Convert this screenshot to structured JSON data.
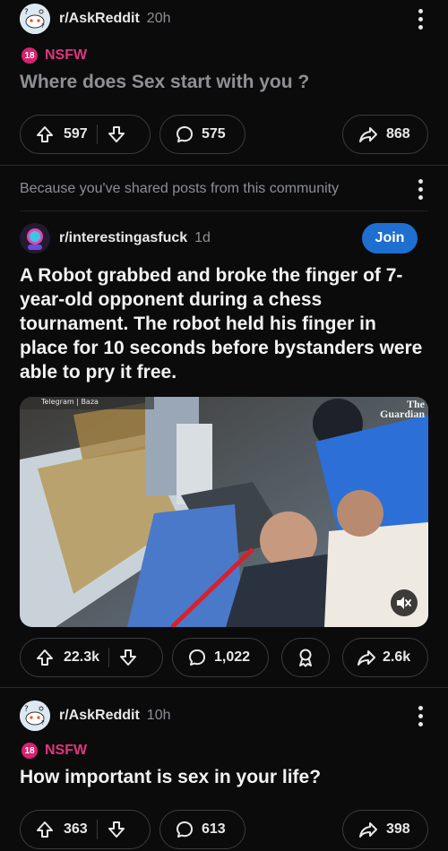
{
  "post1": {
    "subreddit": "r/AskReddit",
    "time": "20h",
    "nsfw_badge": "18",
    "nsfw_label": "NSFW",
    "title": "Where does Sex start with you ?",
    "upvotes": "597",
    "comments": "575",
    "shares": "868"
  },
  "recommendation": {
    "text": "Because you've shared posts from this community"
  },
  "post2": {
    "subreddit": "r/interestingasfuck",
    "time": "1d",
    "join_label": "Join",
    "title": "A Robot grabbed and broke the finger of 7-year-old opponent during a chess tournament. The robot held his finger in place for 10 seconds before bystanders were able to pry it free.",
    "video_watermark": "Telegram | Baza",
    "video_logo": "The Guardian",
    "upvotes": "22.3k",
    "comments": "1,022",
    "shares": "2.6k"
  },
  "post3": {
    "subreddit": "r/AskReddit",
    "time": "10h",
    "nsfw_badge": "18",
    "nsfw_label": "NSFW",
    "title": "How important is sex in your life?",
    "upvotes": "363",
    "comments": "613",
    "shares": "398"
  },
  "colors": {
    "background": "#0b0b0c",
    "nsfw": "#e1357f",
    "join_button": "#1f6fd1",
    "pill_border": "#3a3c3f"
  }
}
